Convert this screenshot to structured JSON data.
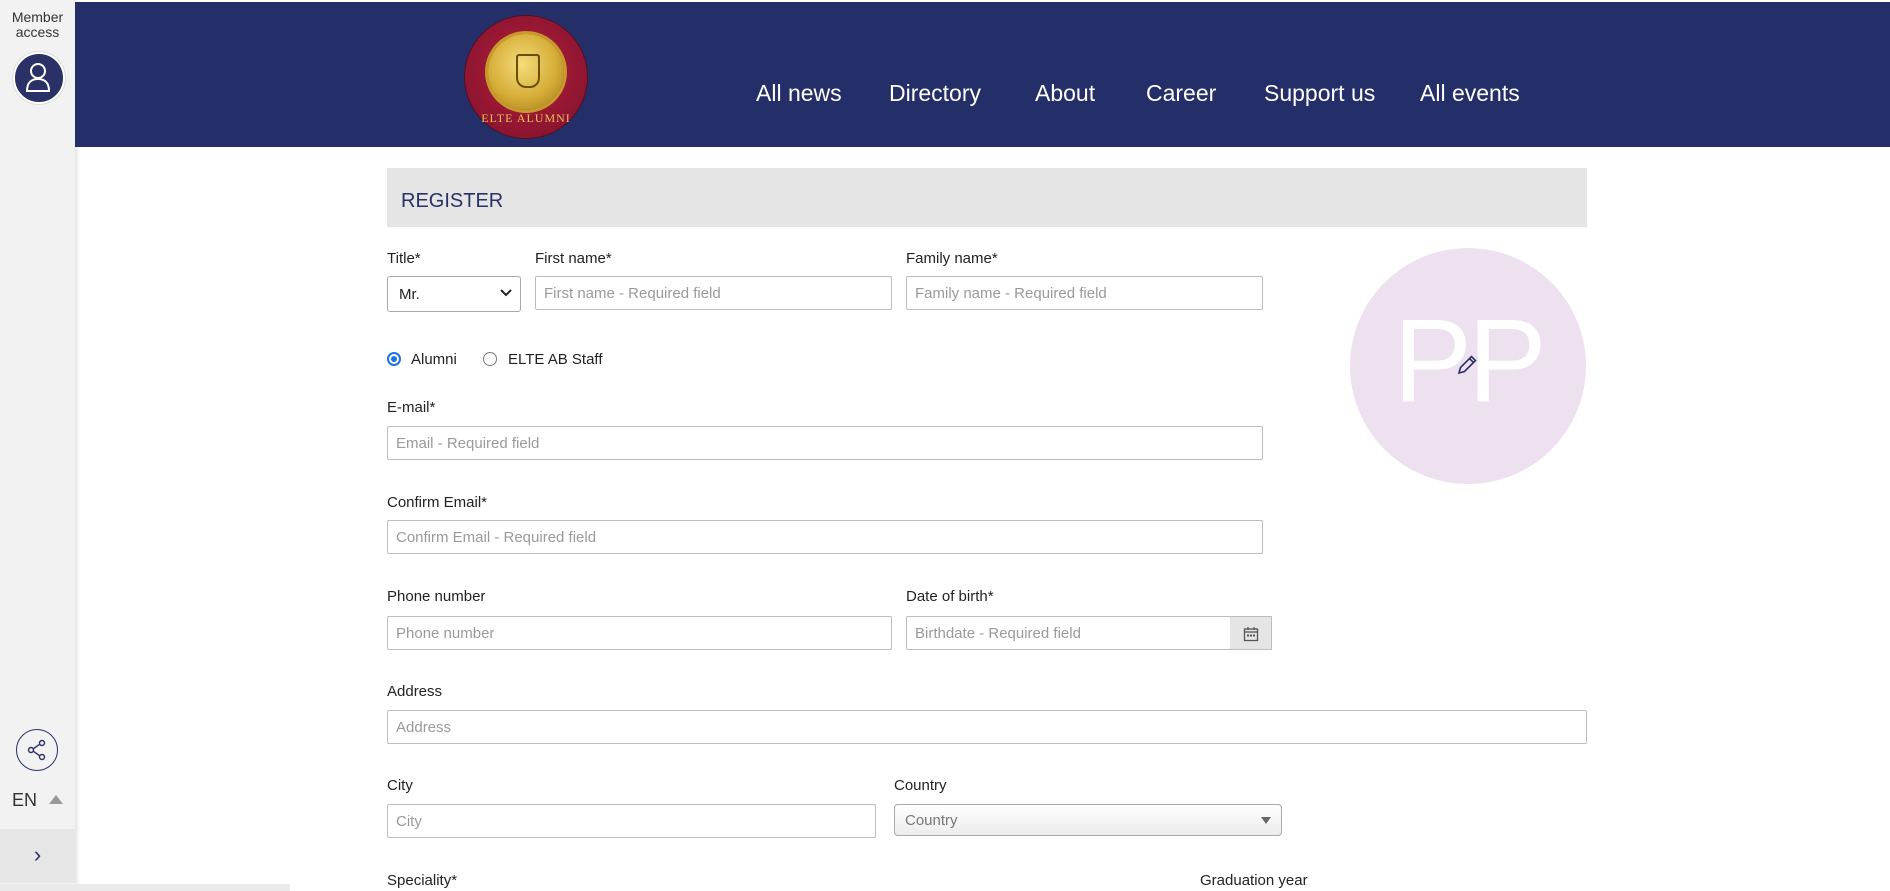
{
  "rail": {
    "member_access": "Member access",
    "language": "EN",
    "expand_glyph": "›"
  },
  "header": {
    "logo_text": "ELTE ALUMNI",
    "nav": [
      "All news",
      "Directory",
      "About",
      "Career",
      "Support us",
      "All events"
    ]
  },
  "form": {
    "heading": "REGISTER",
    "title_label": "Title*",
    "title_value": "Mr.",
    "first_name_label": "First name*",
    "first_name_placeholder": "First name - Required field",
    "family_name_label": "Family name*",
    "family_name_placeholder": "Family name - Required field",
    "member_type": {
      "options": [
        "Alumni",
        "ELTE AB Staff"
      ],
      "selected": "Alumni"
    },
    "email_label": "E-mail*",
    "email_placeholder": "Email - Required field",
    "confirm_email_label": "Confirm Email*",
    "confirm_email_placeholder": "Confirm Email - Required field",
    "phone_label": "Phone number",
    "phone_placeholder": "Phone number",
    "dob_label": "Date of birth*",
    "dob_placeholder": "Birthdate - Required field",
    "address_label": "Address",
    "address_placeholder": "Address",
    "city_label": "City",
    "city_placeholder": "City",
    "country_label": "Country",
    "country_value": "Country",
    "speciality_label": "Speciality*",
    "graduation_year_label": "Graduation year"
  },
  "photo": {
    "initials": "PP",
    "background": "#ede1ef"
  },
  "colors": {
    "header_bg": "#242e68",
    "accent": "#2a3167",
    "radio_selected": "#1a73e8"
  }
}
